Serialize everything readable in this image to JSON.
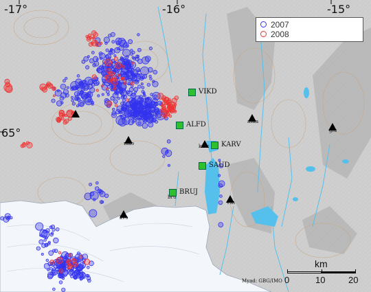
{
  "map": {
    "longitude_labels": [
      "-17°",
      "-16°",
      "-15°"
    ],
    "latitude_label": "65°",
    "legend": [
      {
        "label": "2007",
        "color": "#3333ee"
      },
      {
        "label": "2008",
        "color": "#ee3333"
      }
    ],
    "gps_stations": [
      "VIKD",
      "ALFD",
      "KARV",
      "SAUD",
      "BRUJ"
    ],
    "seismic_stations": [
      "mko",
      "kvo",
      "vsh",
      "aska",
      "glu",
      "krac",
      "bru"
    ],
    "scale_bar": {
      "unit": "km",
      "ticks": [
        "0",
        "10",
        "20"
      ]
    },
    "credit": "Myad: GBG/IMO",
    "colors": {
      "land": "#cfcfcf",
      "ice": "#f3f6fa",
      "water": "#55c0ec",
      "gps_marker": "#2fbf2f",
      "seismometer": "#000000"
    }
  }
}
